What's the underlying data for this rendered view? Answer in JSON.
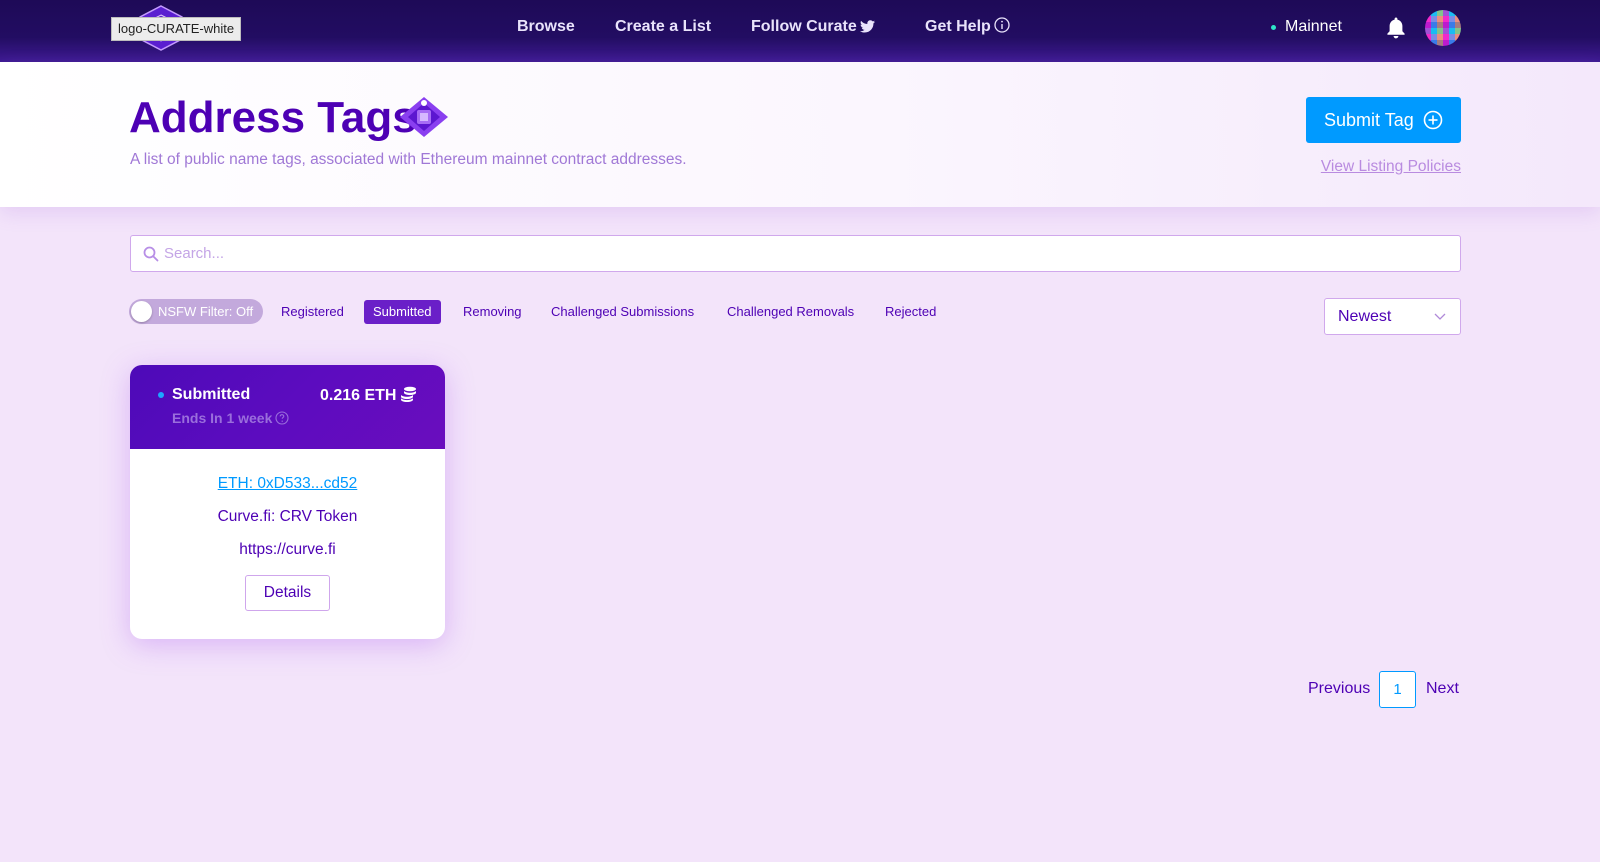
{
  "nav": {
    "logo_alt": "logo-CURATE-white",
    "links": [
      "Browse",
      "Create a List",
      "Follow Curate",
      "Get Help"
    ],
    "network": "Mainnet"
  },
  "header": {
    "title": "Address Tags",
    "subtitle": "A list of public name tags, associated with Ethereum mainnet contract addresses.",
    "submit_label": "Submit Tag",
    "policies_link": "View Listing Policies"
  },
  "search": {
    "placeholder": "Search..."
  },
  "filters": {
    "nsfw_label": "NSFW Filter: Off",
    "items": [
      "Registered",
      "Submitted",
      "Removing",
      "Challenged Submissions",
      "Challenged Removals",
      "Rejected"
    ],
    "active": "Submitted"
  },
  "sort": {
    "selected": "Newest"
  },
  "items": [
    {
      "status": "Submitted",
      "ends": "Ends In 1 week",
      "deposit": "0.216 ETH",
      "address": "ETH: 0xD533...cd52",
      "name": "Curve.fi: CRV Token",
      "url": "https://curve.fi",
      "details_label": "Details"
    }
  ],
  "pagination": {
    "previous": "Previous",
    "current": "1",
    "next": "Next"
  },
  "colors": {
    "primary": "#4d00b4",
    "accent_blue": "#009aff",
    "active_filter": "#6a1fc8",
    "nav_bg": "#220d62"
  }
}
